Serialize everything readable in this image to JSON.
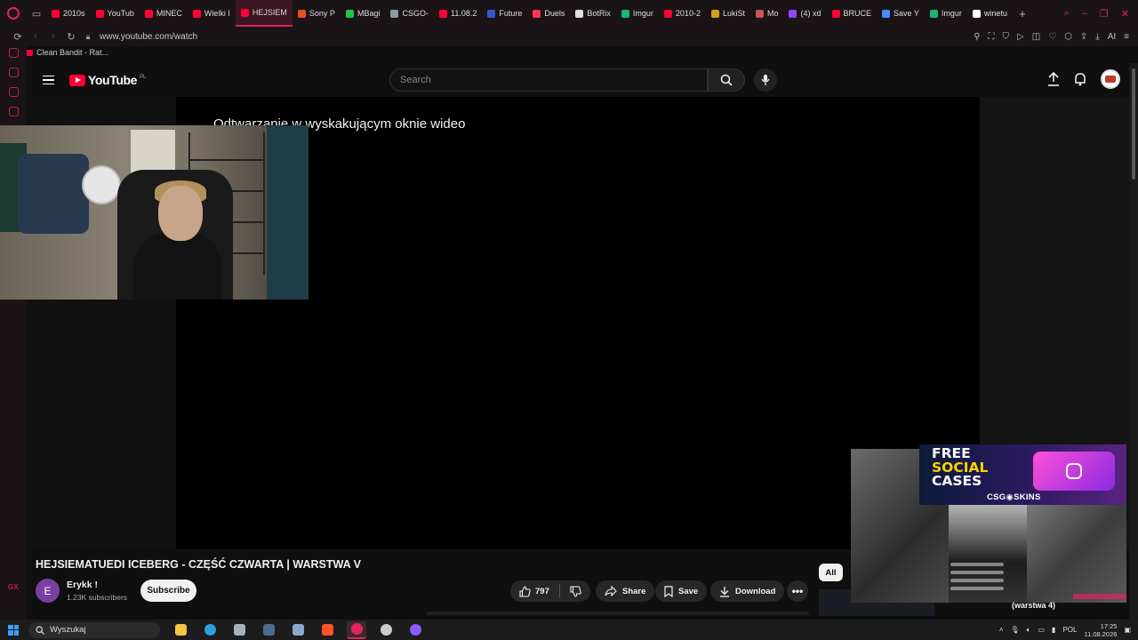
{
  "browser": {
    "tabs": [
      {
        "label": "2010s",
        "color": "#ff0033"
      },
      {
        "label": "YouTub",
        "color": "#ff0033"
      },
      {
        "label": "MINEC",
        "color": "#ff0033"
      },
      {
        "label": "Wielki I",
        "color": "#ff0033"
      },
      {
        "label": "HEJSIEM",
        "color": "#ff0033",
        "active": true
      },
      {
        "label": "Sony P",
        "color": "#e8501c"
      },
      {
        "label": "MBagi",
        "color": "#24c24a"
      },
      {
        "label": "CSGO-",
        "color": "#8899aa"
      },
      {
        "label": "11.08.2",
        "color": "#ff0033"
      },
      {
        "label": "Future",
        "color": "#3355cc"
      },
      {
        "label": "Duels",
        "color": "#ff3355"
      },
      {
        "label": "BotRix",
        "color": "#dddddd"
      },
      {
        "label": "Imgur",
        "color": "#1bb76e"
      },
      {
        "label": "2010-2",
        "color": "#ff0033"
      },
      {
        "label": "LukiSt",
        "color": "#d4a017"
      },
      {
        "label": "Mo",
        "color": "#cc5555"
      },
      {
        "label": "(4) xd",
        "color": "#9146ff"
      },
      {
        "label": "BRUCE",
        "color": "#ff0033"
      },
      {
        "label": "Save Y",
        "color": "#4a8cff"
      },
      {
        "label": "Imgur",
        "color": "#1bb76e"
      },
      {
        "label": "winetu",
        "color": "#ffffff"
      }
    ],
    "url": "www.youtube.com/watch",
    "bookmark": "Clean Bandit - Rat..."
  },
  "youtube": {
    "logo_text": "YouTube",
    "country_code": "PL",
    "search_placeholder": "Search",
    "pip_message": "Odtwarzanie w wyskakującym oknie wideo",
    "video": {
      "title": "HEJSIEMATUEDI ICEBERG - CZĘŚĆ CZWARTA | WARSTWA V",
      "channel_initial": "E",
      "channel_name": "Erykk !",
      "subscribers": "1.23K subscribers",
      "subscribe_label": "Subscribe",
      "likes": "797",
      "share_label": "Share",
      "save_label": "Save",
      "download_label": "Download",
      "more_label": "•••"
    },
    "chip_all": "All"
  },
  "overlay": {
    "ad_line1": "FREE",
    "ad_line2": "SOCIAL",
    "ad_line3": "CASES",
    "ad_brand": "CSG◉SKINS",
    "caption": "(warstwa 4)"
  },
  "taskbar": {
    "search_placeholder": "Wyszukaj",
    "language": "POL",
    "time": "17:25",
    "date": "11.08.2026",
    "apps": [
      {
        "name": "file-explorer",
        "color": "#f4c542"
      },
      {
        "name": "edge",
        "color": "#2fa0d8"
      },
      {
        "name": "app-gray",
        "color": "#aab0b8"
      },
      {
        "name": "steam",
        "color": "#4c6b8a"
      },
      {
        "name": "settings",
        "color": "#8aa8c8"
      },
      {
        "name": "brave",
        "color": "#fb542b"
      },
      {
        "name": "opera-gx",
        "color": "#e0245e",
        "active": true
      },
      {
        "name": "obs",
        "color": "#cccccc"
      },
      {
        "name": "app-purple",
        "color": "#8a5cff"
      }
    ]
  }
}
